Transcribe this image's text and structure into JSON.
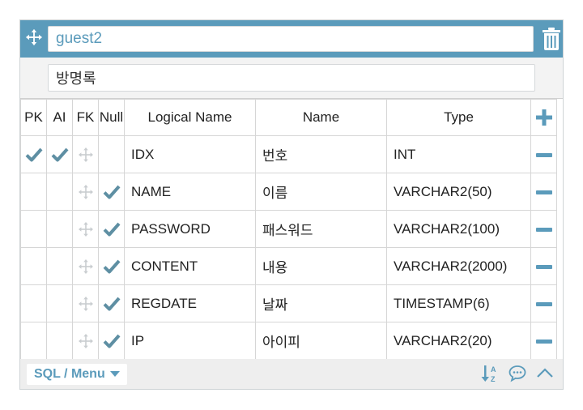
{
  "table_editor": {
    "table_name": "guest2",
    "table_comment": "방명록",
    "columns_header": {
      "pk": "PK",
      "ai": "AI",
      "fk": "FK",
      "null": "Null",
      "logical_name": "Logical Name",
      "name": "Name",
      "type": "Type"
    },
    "rows": [
      {
        "pk": true,
        "ai": true,
        "fk": false,
        "null": false,
        "logical_name": "IDX",
        "name": "번호",
        "type": "INT"
      },
      {
        "pk": false,
        "ai": false,
        "fk": false,
        "null": true,
        "logical_name": "NAME",
        "name": "이름",
        "type": "VARCHAR2(50)"
      },
      {
        "pk": false,
        "ai": false,
        "fk": false,
        "null": true,
        "logical_name": "PASSWORD",
        "name": "패스워드",
        "type": "VARCHAR2(100)"
      },
      {
        "pk": false,
        "ai": false,
        "fk": false,
        "null": true,
        "logical_name": "CONTENT",
        "name": "내용",
        "type": "VARCHAR2(2000)"
      },
      {
        "pk": false,
        "ai": false,
        "fk": false,
        "null": true,
        "logical_name": "REGDATE",
        "name": "날짜",
        "type": "TIMESTAMP(6)"
      },
      {
        "pk": false,
        "ai": false,
        "fk": false,
        "null": true,
        "logical_name": "IP",
        "name": "아이피",
        "type": "VARCHAR2(20)"
      }
    ],
    "footer": {
      "menu_label": "SQL / Menu"
    }
  },
  "icons": {
    "header_left": "move-icon",
    "header_right": "trash-icon",
    "add_column": "plus-icon",
    "remove_column": "minus-icon",
    "fk_handle": "drag-handle-icon",
    "check": "checkmark-icon",
    "footer": [
      "sort-az-icon",
      "comment-icon",
      "collapse-icon"
    ]
  },
  "colors": {
    "accent": "#5b9bbb",
    "check": "#5e8fa3",
    "handle": "#c9cdd0",
    "border": "#d6d6d6"
  }
}
